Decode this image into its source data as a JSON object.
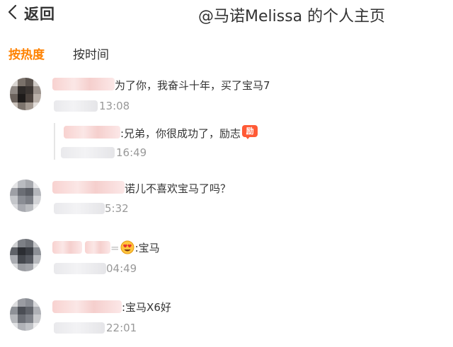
{
  "header": {
    "back_label": "返回",
    "title": "@马诺Melissa 的个人主页"
  },
  "tabs": [
    {
      "label": "按热度",
      "active": true
    },
    {
      "label": "按时间",
      "active": false
    }
  ],
  "accent_color": "#ff8200",
  "comments": [
    {
      "text": "为了你，我奋斗十年，买了宝马7",
      "time": "13:08"
    },
    {
      "text": "诺儿不喜欢宝马了吗？",
      "time": "5:32"
    },
    {
      "text_prefix": "=",
      "emoji": "heart-eyes-emoji",
      "text": ":宝马",
      "time": "04:49"
    },
    {
      "text": ":宝马X6好",
      "time": "22:01"
    }
  ],
  "reply": {
    "text": ":兄弟，你很成功了，励志",
    "badge": "励",
    "time": "16:49"
  }
}
